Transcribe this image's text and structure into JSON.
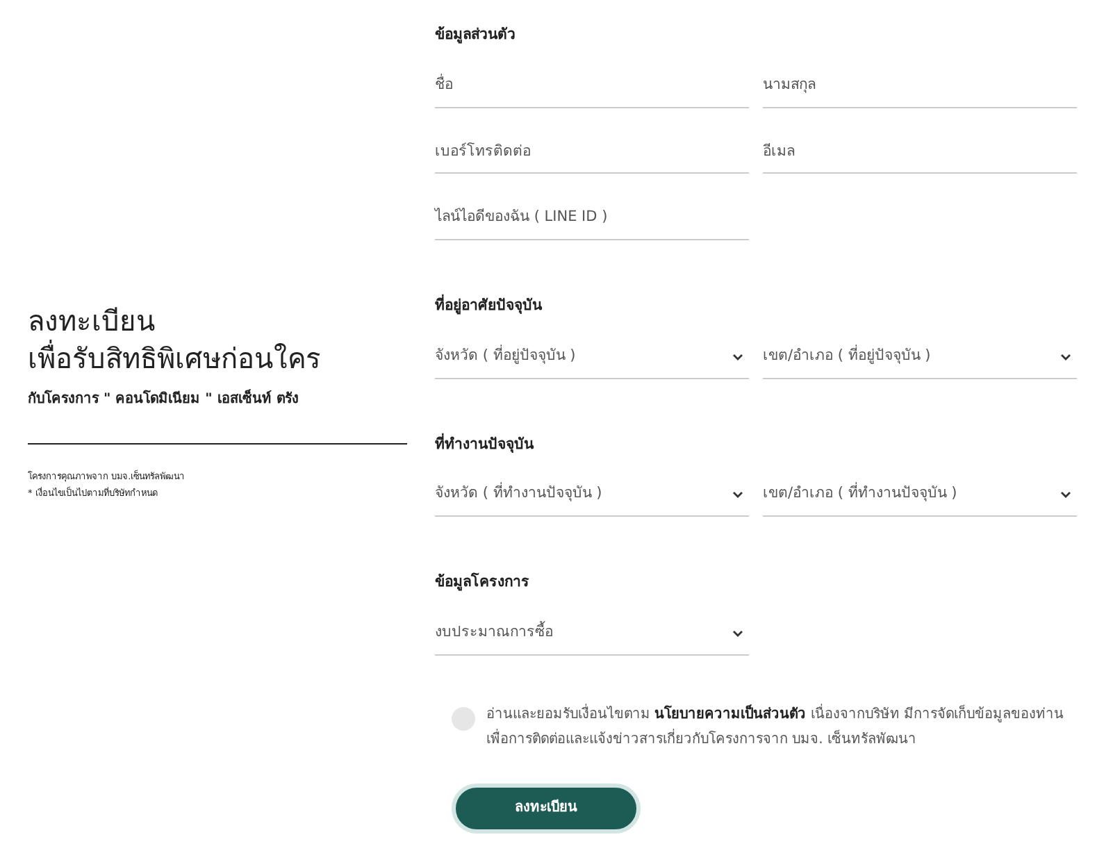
{
  "intro": {
    "title_lines": [
      "ลงทะเบียน",
      "เพื่อรับสิทธิพิเศษก่อนใคร"
    ],
    "subtitle": "กับโครงการ \" คอนโดมิเนียม \" เอสเซ็นท์ ตรัง",
    "notes": [
      "โครงการคุณภาพจาก บมจ.เซ็นทรัลพัฒนา",
      "* เงื่อนไขเป็นไปตามที่บริษัทกำหนด"
    ]
  },
  "sections": [
    {
      "heading": "ข้อมูลส่วนตัว",
      "fields": [
        {
          "kind": "input",
          "placeholder": "ชื่อ"
        },
        {
          "kind": "input",
          "placeholder": "นามสกุล"
        },
        {
          "kind": "input",
          "placeholder": "เบอร์โทรติดต่อ"
        },
        {
          "kind": "input",
          "placeholder": "อีเมล"
        },
        {
          "kind": "input",
          "placeholder": "ไลน์ไอดีของฉัน ( LINE ID )"
        }
      ]
    },
    {
      "heading": "ที่อยู่อาศัยปัจจุบัน",
      "fields": [
        {
          "kind": "select",
          "placeholder": "จังหวัด ( ที่อยู่ปัจจุบัน )"
        },
        {
          "kind": "select",
          "placeholder": "เขต/อำเภอ ( ที่อยู่ปัจจุบัน )"
        }
      ]
    },
    {
      "heading": "ที่ทำงานปัจจุบัน",
      "fields": [
        {
          "kind": "select",
          "placeholder": "จังหวัด ( ที่ทำงานปัจจุบัน )"
        },
        {
          "kind": "select",
          "placeholder": "เขต/อำเภอ ( ที่ทำงานปัจจุบัน )"
        }
      ]
    },
    {
      "heading": "ข้อมูลโครงการ",
      "fields": [
        {
          "kind": "select",
          "placeholder": "งบประมาณการซื้อ"
        }
      ]
    }
  ],
  "consent": {
    "checked": false,
    "text": "อ่านและยอมรับเงื่อนไขตาม **นโยบายความเป็นส่วนตัว** เนื่องจากบริษัท มีการจัดเก็บข้อมูลของท่าน เพื่อการติดต่อและแจ้งข่าวสารเกี่ยวกับโครงการจาก บมจ. เซ็นทรัลพัฒนา"
  },
  "submit": {
    "label": "ลงทะเบียน"
  }
}
